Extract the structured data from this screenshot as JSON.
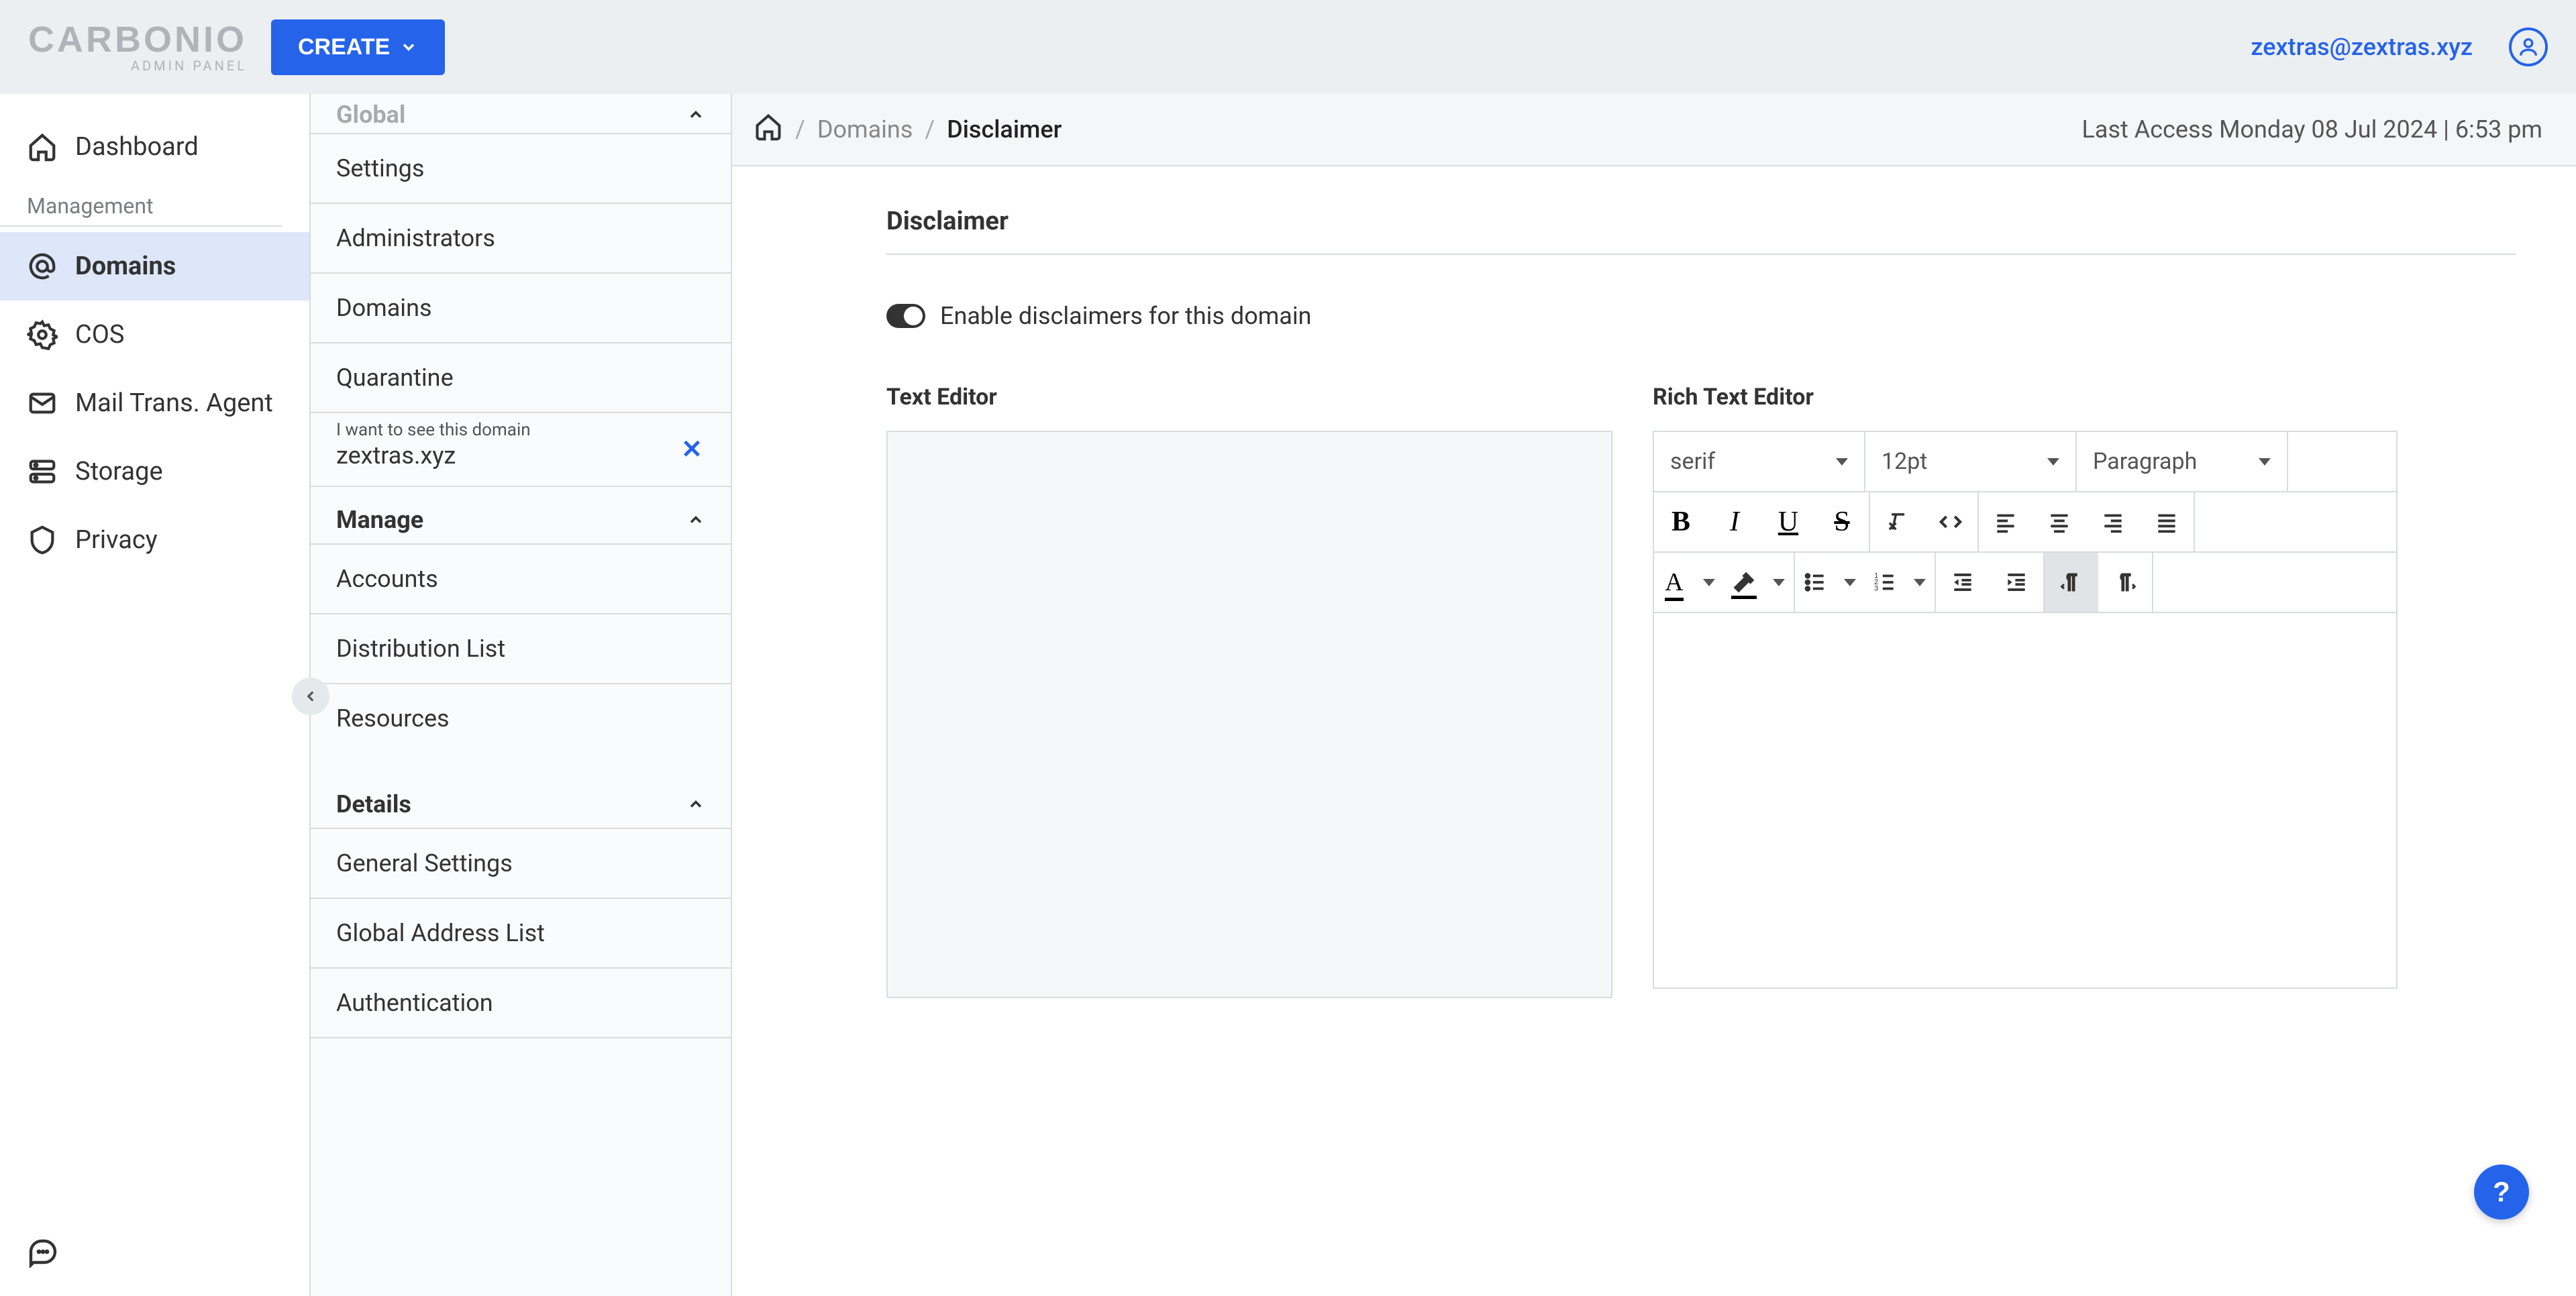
{
  "brand": {
    "name": "CARBONIO",
    "sub": "ADMIN PANEL"
  },
  "header": {
    "create_label": "CREATE",
    "user_email": "zextras@zextras.xyz"
  },
  "nav": {
    "section_label": "Management",
    "items": [
      {
        "label": "Dashboard"
      },
      {
        "label": "Domains"
      },
      {
        "label": "COS"
      },
      {
        "label": "Mail Trans. Agent"
      },
      {
        "label": "Storage"
      },
      {
        "label": "Privacy"
      }
    ],
    "active_index": 1
  },
  "subnav": {
    "global_label": "Global",
    "global_items": [
      {
        "label": "Settings"
      },
      {
        "label": "Administrators"
      },
      {
        "label": "Domains"
      },
      {
        "label": "Quarantine"
      }
    ],
    "filter": {
      "label": "I want to see this domain",
      "value": "zextras.xyz"
    },
    "manage_label": "Manage",
    "manage_items": [
      {
        "label": "Accounts"
      },
      {
        "label": "Distribution List"
      },
      {
        "label": "Resources"
      }
    ],
    "details_label": "Details",
    "details_items": [
      {
        "label": "General Settings"
      },
      {
        "label": "Global Address List"
      },
      {
        "label": "Authentication"
      }
    ]
  },
  "breadcrumb": {
    "parent": "Domains",
    "current": "Disclaimer",
    "last_access": "Last Access Monday 08 Jul 2024 | 6:53 pm"
  },
  "page": {
    "title": "Disclaimer",
    "toggle_label": "Enable disclaimers for this domain",
    "text_editor_title": "Text Editor",
    "rich_editor_title": "Rich Text Editor"
  },
  "rte": {
    "font_family": "serif",
    "font_size": "12pt",
    "block_format": "Paragraph"
  },
  "help": {
    "label": "?"
  }
}
